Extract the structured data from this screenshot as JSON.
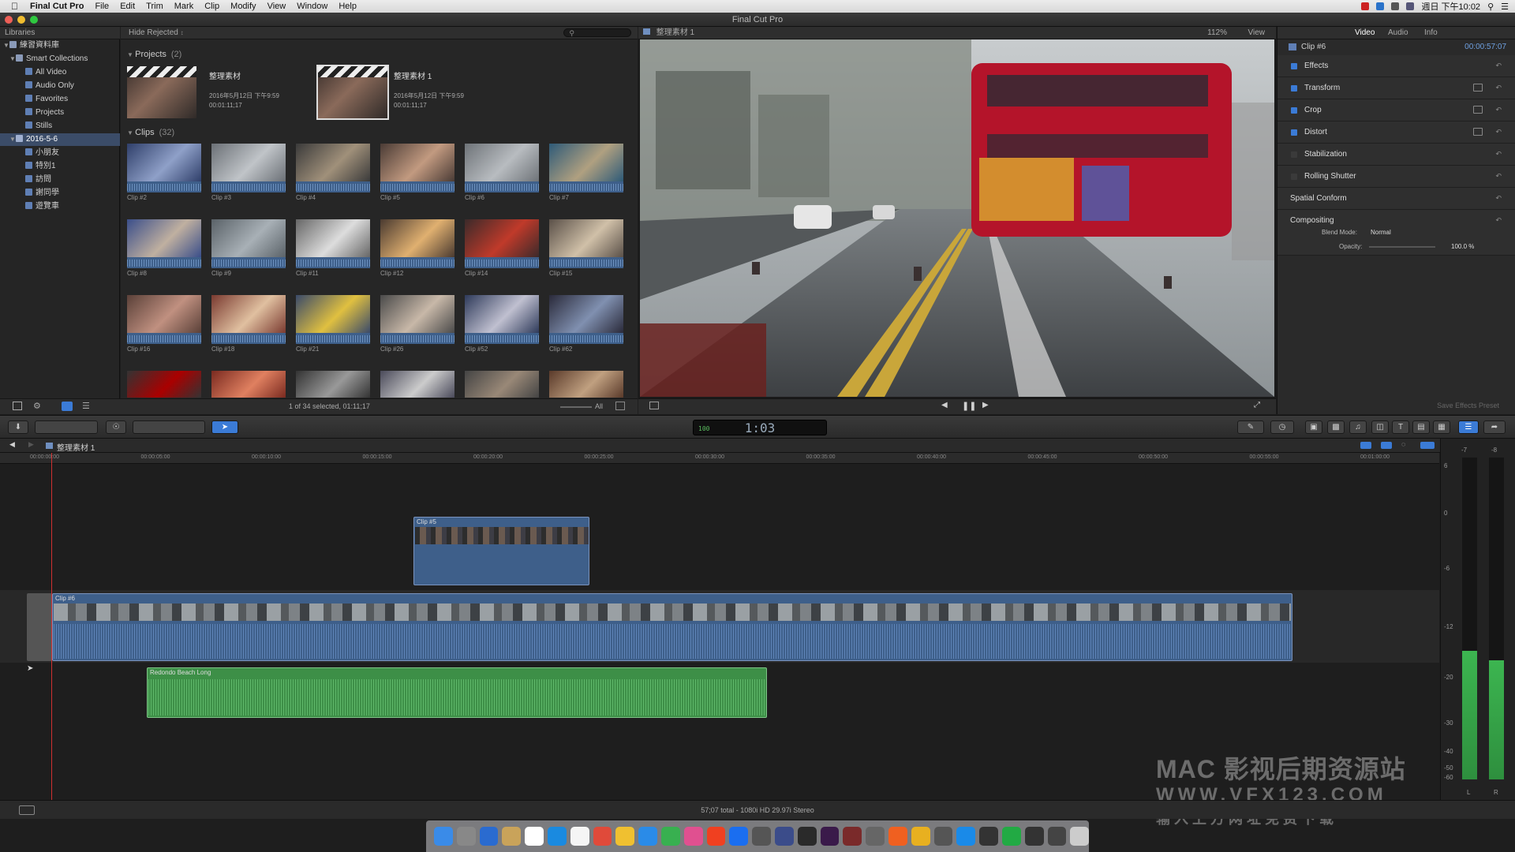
{
  "menubar": {
    "apple": "",
    "app_name": "Final Cut Pro",
    "items": [
      "File",
      "Edit",
      "Trim",
      "Mark",
      "Clip",
      "Modify",
      "View",
      "Window",
      "Help"
    ],
    "clock": "週日 下午10:02"
  },
  "window": {
    "title": "Final Cut Pro"
  },
  "libraries": {
    "header": "Libraries",
    "items": [
      {
        "label": "練習資料庫",
        "level": 0
      },
      {
        "label": "Smart Collections",
        "level": 1
      },
      {
        "label": "All Video",
        "level": 2
      },
      {
        "label": "Audio Only",
        "level": 2
      },
      {
        "label": "Favorites",
        "level": 2
      },
      {
        "label": "Projects",
        "level": 2
      },
      {
        "label": "Stills",
        "level": 2
      },
      {
        "label": "2016-5-6",
        "level": 1
      },
      {
        "label": "小朋友",
        "level": 2
      },
      {
        "label": "特別1",
        "level": 2
      },
      {
        "label": "訪問",
        "level": 2
      },
      {
        "label": "謝同學",
        "level": 2
      },
      {
        "label": "遊覽車",
        "level": 2
      }
    ]
  },
  "browser": {
    "filter": "Hide Rejected",
    "projects_title": "Projects",
    "projects_count": "(2)",
    "projects": [
      {
        "name": "整理素材",
        "date": "2016年5月12日 下午9:59",
        "duration": "00:01:11;17"
      },
      {
        "name": "整理素材 1",
        "date": "2016年5月12日 下午9:59",
        "duration": "00:01:11;17"
      }
    ],
    "clips_title": "Clips",
    "clips_count": "(32)",
    "clips": [
      "Clip #2",
      "Clip #3",
      "Clip #4",
      "Clip #5",
      "Clip #6",
      "Clip #7",
      "Clip #8",
      "Clip #9",
      "Clip #11",
      "Clip #12",
      "Clip #14",
      "Clip #15",
      "Clip #16",
      "Clip #18",
      "Clip #21",
      "Clip #26",
      "Clip #52",
      "Clip #62",
      "",
      "",
      "",
      "",
      "",
      ""
    ],
    "selection_status": "1 of 34 selected, 01:11;17",
    "all_label": "All"
  },
  "viewer": {
    "project_name": "整理素材 1",
    "zoom": "112%",
    "view_menu": "View"
  },
  "inspector": {
    "tabs": [
      "Video",
      "Audio",
      "Info"
    ],
    "clip_name": "Clip #6",
    "clip_duration": "00:00:57:07",
    "rows": [
      "Effects",
      "Transform",
      "Crop",
      "Distort",
      "Stabilization",
      "Rolling Shutter",
      "Spatial Conform",
      "Compositing"
    ],
    "blend_mode_label": "Blend Mode:",
    "blend_mode_value": "Normal",
    "opacity_label": "Opacity:",
    "opacity_value": "100.0 %",
    "save_preset": "Save Effects Preset"
  },
  "toolbar": {
    "timecode_percent": "100",
    "timecode": "1:03"
  },
  "timeline": {
    "project_name": "整理素材 1",
    "ruler_ticks": [
      "00:00:00:00",
      "00:00:05:00",
      "00:00:10:00",
      "00:00:15:00",
      "00:00:20:00",
      "00:00:25:00",
      "00:00:30:00",
      "00:00:35:00",
      "00:00:40:00",
      "00:00:45:00",
      "00:00:50:00",
      "00:00:55:00",
      "00:01:00:00"
    ],
    "connected_clip": "Clip #5",
    "primary_clip": "Clip #6",
    "audio_clip": "Redondo Beach Long",
    "status": "57;07 total - 1080i HD 29.97i Stereo"
  },
  "meters": {
    "scale": [
      "6",
      "0",
      "-6",
      "-12",
      "-20",
      "-30",
      "-40",
      "-50",
      "-60"
    ],
    "top_left": "-7",
    "top_right": "-8",
    "left_label": "L",
    "right_label": "R",
    "left_level": 0.4,
    "right_level": 0.37
  },
  "watermark": {
    "line1": "MAC 影视后期资源站",
    "line2": "WWW.VFX123.COM",
    "line3": "输 入 上 方 网 址   免 费 下 载"
  },
  "colors": {
    "selection": "#3b4c68",
    "accent_blue": "#3b7bd6",
    "audio_green": "#3d8f47",
    "playhead": "#d03030"
  }
}
